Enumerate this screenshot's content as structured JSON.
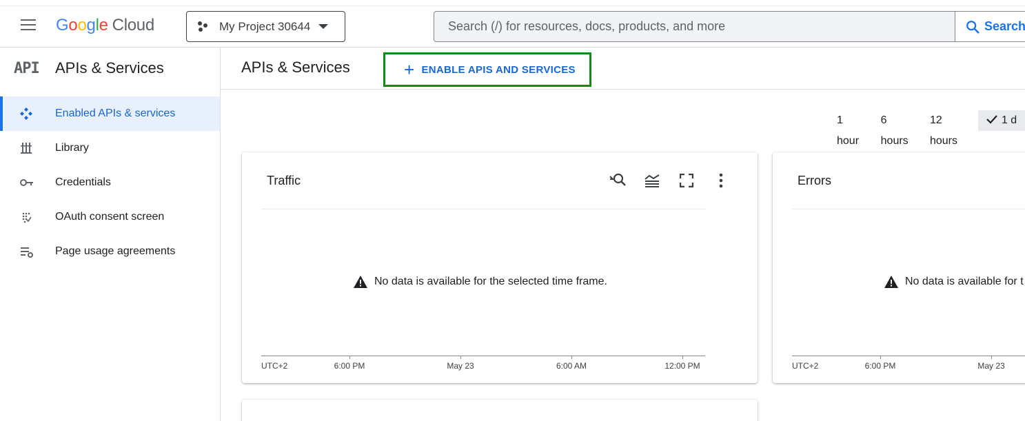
{
  "header": {
    "logo": {
      "g1": "G",
      "g2": "o",
      "g3": "o",
      "g4": "g",
      "g5": "l",
      "g6": "e",
      "cloud": "Cloud"
    },
    "project_name": "My Project 30644",
    "search_placeholder": "Search (/) for resources, docs, products, and more",
    "search_button": "Search"
  },
  "sidebar": {
    "glyph": "API",
    "title": "APIs & Services",
    "items": [
      {
        "label": "Enabled APIs & services",
        "icon": "enabled-apis-icon",
        "active": true
      },
      {
        "label": "Library",
        "icon": "library-icon"
      },
      {
        "label": "Credentials",
        "icon": "key-icon"
      },
      {
        "label": "OAuth consent screen",
        "icon": "oauth-icon"
      },
      {
        "label": "Page usage agreements",
        "icon": "settings-list-icon"
      }
    ]
  },
  "main": {
    "title": "APIs & Services",
    "enable_button": "ENABLE APIS AND SERVICES",
    "time_options": [
      "1 hour",
      "6 hours",
      "12 hours",
      "1 d"
    ],
    "selected_time": "1 d",
    "cards": [
      {
        "title": "Traffic",
        "message": "No data is available for the selected time frame.",
        "timezone": "UTC+2",
        "ticks": [
          "6:00 PM",
          "May 23",
          "6:00 AM",
          "12:00 PM"
        ]
      },
      {
        "title": "Errors",
        "message": "No data is available for t",
        "timezone": "UTC+2",
        "ticks": [
          "6:00 PM",
          "May 23"
        ]
      }
    ]
  },
  "colors": {
    "accent": "#1a73e8",
    "active_bg": "#e8f0fe",
    "highlight_border": "#138a13"
  }
}
